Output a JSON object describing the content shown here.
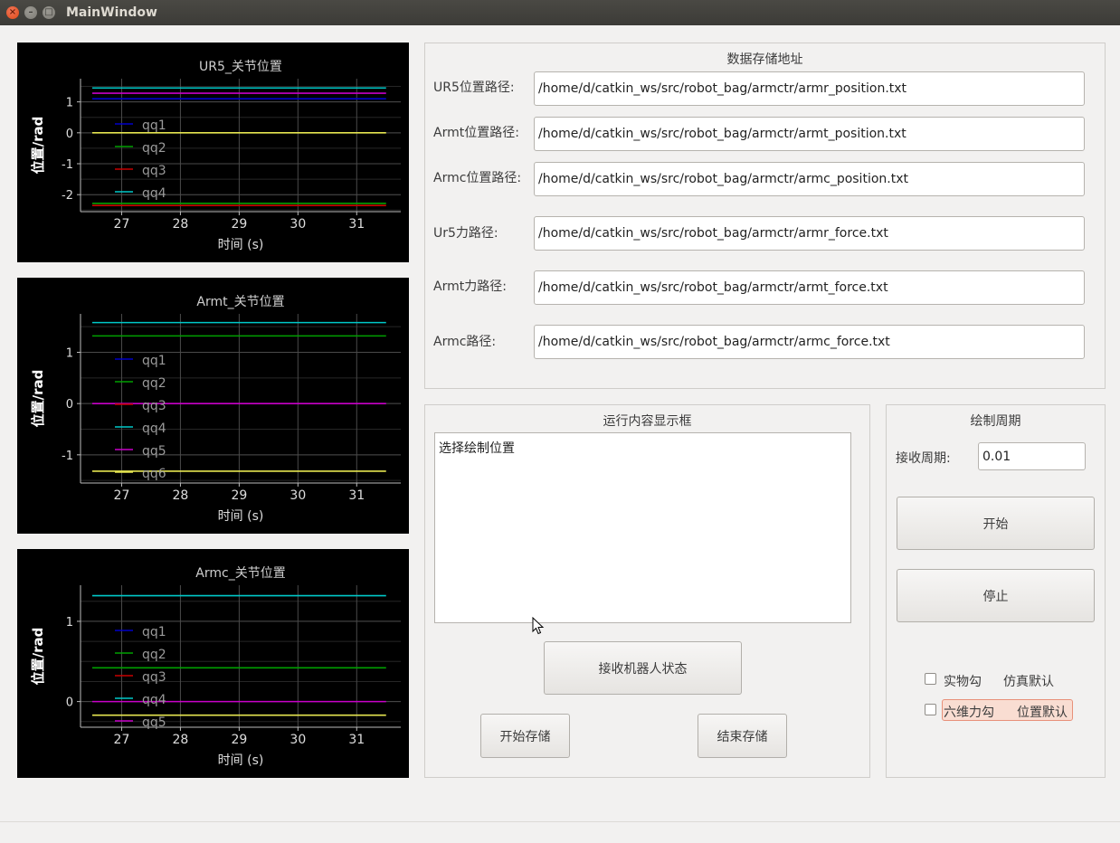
{
  "window": {
    "title": "MainWindow"
  },
  "plots": [
    {
      "title": "UR5_关节位置",
      "ylabel": "位置/rad",
      "xlabel": "时间 (s)",
      "xticks": [
        27,
        28,
        29,
        30,
        31
      ],
      "yticks": [
        1,
        0,
        -1,
        -2
      ],
      "xrange": [
        26.3,
        31.75
      ],
      "yrange": [
        -2.55,
        1.75
      ],
      "lines": [
        {
          "value": 1.45,
          "color": "#00c8c8"
        },
        {
          "value": 1.28,
          "color": "#c800c8"
        },
        {
          "value": 1.1,
          "color": "#0000c8"
        },
        {
          "value": 0.0,
          "color": "#e6e650"
        },
        {
          "value": -2.28,
          "color": "#00a000"
        },
        {
          "value": -2.35,
          "color": "#c80000"
        }
      ],
      "legend": [
        {
          "label": "qq1",
          "color": "#0000c8"
        },
        {
          "label": "qq2",
          "color": "#00a000"
        },
        {
          "label": "qq3",
          "color": "#c80000"
        },
        {
          "label": "qq4",
          "color": "#00c8c8"
        }
      ]
    },
    {
      "title": "Armt_关节位置",
      "ylabel": "位置/rad",
      "xlabel": "时间 (s)",
      "xticks": [
        27,
        28,
        29,
        30,
        31
      ],
      "yticks": [
        1,
        0,
        -1
      ],
      "xrange": [
        26.3,
        31.75
      ],
      "yrange": [
        -1.55,
        1.75
      ],
      "lines": [
        {
          "value": 1.58,
          "color": "#00c8c8"
        },
        {
          "value": 1.32,
          "color": "#00a000"
        },
        {
          "value": 0.0,
          "color": "#c800c8"
        },
        {
          "value": -1.32,
          "color": "#e6e650"
        }
      ],
      "legend": [
        {
          "label": "qq1",
          "color": "#0000c8"
        },
        {
          "label": "qq2",
          "color": "#00a000"
        },
        {
          "label": "qq3",
          "color": "#c80000"
        },
        {
          "label": "qq4",
          "color": "#00c8c8"
        },
        {
          "label": "qq5",
          "color": "#c800c8"
        },
        {
          "label": "qq6",
          "color": "#e6e650"
        }
      ]
    },
    {
      "title": "Armc_关节位置",
      "ylabel": "位置/rad",
      "xlabel": "时间 (s)",
      "xticks": [
        27,
        28,
        29,
        30,
        31
      ],
      "yticks": [
        1,
        0
      ],
      "xrange": [
        26.3,
        31.75
      ],
      "yrange": [
        -0.32,
        1.45
      ],
      "lines": [
        {
          "value": 1.32,
          "color": "#00c8c8"
        },
        {
          "value": 0.42,
          "color": "#00a000"
        },
        {
          "value": 0.0,
          "color": "#c800c8"
        },
        {
          "value": -0.17,
          "color": "#e6e650"
        }
      ],
      "legend": [
        {
          "label": "qq1",
          "color": "#0000c8"
        },
        {
          "label": "qq2",
          "color": "#00a000"
        },
        {
          "label": "qq3",
          "color": "#c80000"
        },
        {
          "label": "qq4",
          "color": "#00c8c8"
        },
        {
          "label": "qq5",
          "color": "#c800c8"
        }
      ]
    }
  ],
  "storage": {
    "title": "数据存储地址",
    "rows": [
      {
        "label": "UR5位置路径:",
        "value": "/home/d/catkin_ws/src/robot_bag/armctr/armr_position.txt"
      },
      {
        "label": "Armt位置路径:",
        "value": "/home/d/catkin_ws/src/robot_bag/armctr/armt_position.txt"
      },
      {
        "label": "Armc位置路径:",
        "value": "/home/d/catkin_ws/src/robot_bag/armctr/armc_position.txt"
      },
      {
        "label": "Ur5力路径:",
        "value": "/home/d/catkin_ws/src/robot_bag/armctr/armr_force.txt"
      },
      {
        "label": "Armt力路径:",
        "value": "/home/d/catkin_ws/src/robot_bag/armctr/armt_force.txt"
      },
      {
        "label": "Armc路径:",
        "value": "/home/d/catkin_ws/src/robot_bag/armctr/armc_force.txt"
      }
    ]
  },
  "runbox": {
    "title": "运行内容显示框",
    "content": "选择绘制位置",
    "receive_label": "接收机器人状态",
    "start_store_label": "开始存储",
    "stop_store_label": "结束存储"
  },
  "period": {
    "title": "绘制周期",
    "receive_label": "接收周期:",
    "receive_value": "0.01",
    "start_label": "开始",
    "stop_label": "停止",
    "check1_a": "实物勾",
    "check1_b": "仿真默认",
    "check2_a": "六维力勾",
    "check2_b": "位置默认"
  }
}
